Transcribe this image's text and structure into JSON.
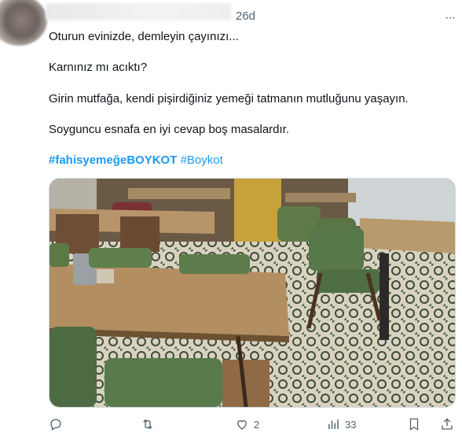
{
  "post": {
    "timestamp": "26d",
    "more_icon": "more-dots-icon",
    "paragraphs": [
      "Oturun evinizde, demleyin çayınızı...",
      "Karnınız mı acıktı?",
      "Girin mutfağa, kendi pişirdiğiniz yemeği tatmanın mutluğunu yaşayın.",
      "Soyguncu esnafa en iyi cevap boş masalardır."
    ],
    "hashtags": [
      "#fahisyemeğeBOYKOT",
      "#Boykot"
    ],
    "media_description_icon": "restaurant-photo"
  },
  "actions": {
    "reply_icon": "reply-icon",
    "retweet_icon": "retweet-icon",
    "like_icon": "heart-icon",
    "like_count": "2",
    "views_icon": "views-icon",
    "views_count": "33",
    "bookmark_icon": "bookmark-icon",
    "share_icon": "share-icon"
  },
  "colors": {
    "link": "#1d9bf0",
    "text": "#0f1419",
    "muted": "#536471"
  }
}
